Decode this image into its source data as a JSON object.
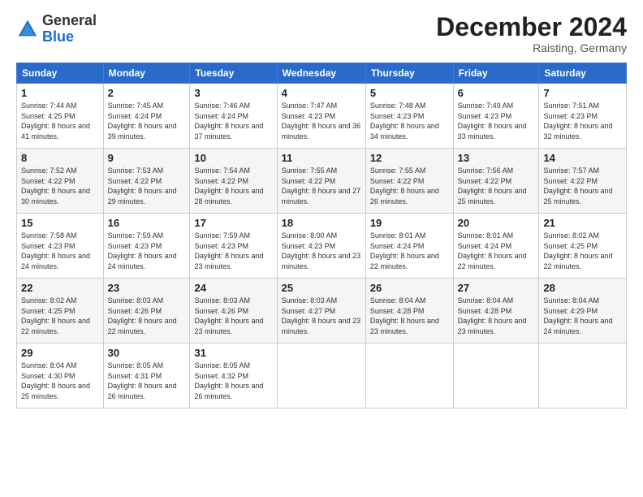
{
  "logo": {
    "general": "General",
    "blue": "Blue"
  },
  "header": {
    "month": "December 2024",
    "location": "Raisting, Germany"
  },
  "weekdays": [
    "Sunday",
    "Monday",
    "Tuesday",
    "Wednesday",
    "Thursday",
    "Friday",
    "Saturday"
  ],
  "weeks": [
    [
      {
        "day": "1",
        "sunrise": "7:44 AM",
        "sunset": "4:25 PM",
        "daylight": "8 hours and 41 minutes."
      },
      {
        "day": "2",
        "sunrise": "7:45 AM",
        "sunset": "4:24 PM",
        "daylight": "8 hours and 39 minutes."
      },
      {
        "day": "3",
        "sunrise": "7:46 AM",
        "sunset": "4:24 PM",
        "daylight": "8 hours and 37 minutes."
      },
      {
        "day": "4",
        "sunrise": "7:47 AM",
        "sunset": "4:23 PM",
        "daylight": "8 hours and 36 minutes."
      },
      {
        "day": "5",
        "sunrise": "7:48 AM",
        "sunset": "4:23 PM",
        "daylight": "8 hours and 34 minutes."
      },
      {
        "day": "6",
        "sunrise": "7:49 AM",
        "sunset": "4:23 PM",
        "daylight": "8 hours and 33 minutes."
      },
      {
        "day": "7",
        "sunrise": "7:51 AM",
        "sunset": "4:23 PM",
        "daylight": "8 hours and 32 minutes."
      }
    ],
    [
      {
        "day": "8",
        "sunrise": "7:52 AM",
        "sunset": "4:22 PM",
        "daylight": "8 hours and 30 minutes."
      },
      {
        "day": "9",
        "sunrise": "7:53 AM",
        "sunset": "4:22 PM",
        "daylight": "8 hours and 29 minutes."
      },
      {
        "day": "10",
        "sunrise": "7:54 AM",
        "sunset": "4:22 PM",
        "daylight": "8 hours and 28 minutes."
      },
      {
        "day": "11",
        "sunrise": "7:55 AM",
        "sunset": "4:22 PM",
        "daylight": "8 hours and 27 minutes."
      },
      {
        "day": "12",
        "sunrise": "7:55 AM",
        "sunset": "4:22 PM",
        "daylight": "8 hours and 26 minutes."
      },
      {
        "day": "13",
        "sunrise": "7:56 AM",
        "sunset": "4:22 PM",
        "daylight": "8 hours and 25 minutes."
      },
      {
        "day": "14",
        "sunrise": "7:57 AM",
        "sunset": "4:22 PM",
        "daylight": "8 hours and 25 minutes."
      }
    ],
    [
      {
        "day": "15",
        "sunrise": "7:58 AM",
        "sunset": "4:23 PM",
        "daylight": "8 hours and 24 minutes."
      },
      {
        "day": "16",
        "sunrise": "7:59 AM",
        "sunset": "4:23 PM",
        "daylight": "8 hours and 24 minutes."
      },
      {
        "day": "17",
        "sunrise": "7:59 AM",
        "sunset": "4:23 PM",
        "daylight": "8 hours and 23 minutes."
      },
      {
        "day": "18",
        "sunrise": "8:00 AM",
        "sunset": "4:23 PM",
        "daylight": "8 hours and 23 minutes."
      },
      {
        "day": "19",
        "sunrise": "8:01 AM",
        "sunset": "4:24 PM",
        "daylight": "8 hours and 22 minutes."
      },
      {
        "day": "20",
        "sunrise": "8:01 AM",
        "sunset": "4:24 PM",
        "daylight": "8 hours and 22 minutes."
      },
      {
        "day": "21",
        "sunrise": "8:02 AM",
        "sunset": "4:25 PM",
        "daylight": "8 hours and 22 minutes."
      }
    ],
    [
      {
        "day": "22",
        "sunrise": "8:02 AM",
        "sunset": "4:25 PM",
        "daylight": "8 hours and 22 minutes."
      },
      {
        "day": "23",
        "sunrise": "8:03 AM",
        "sunset": "4:26 PM",
        "daylight": "8 hours and 22 minutes."
      },
      {
        "day": "24",
        "sunrise": "8:03 AM",
        "sunset": "4:26 PM",
        "daylight": "8 hours and 23 minutes."
      },
      {
        "day": "25",
        "sunrise": "8:03 AM",
        "sunset": "4:27 PM",
        "daylight": "8 hours and 23 minutes."
      },
      {
        "day": "26",
        "sunrise": "8:04 AM",
        "sunset": "4:28 PM",
        "daylight": "8 hours and 23 minutes."
      },
      {
        "day": "27",
        "sunrise": "8:04 AM",
        "sunset": "4:28 PM",
        "daylight": "8 hours and 23 minutes."
      },
      {
        "day": "28",
        "sunrise": "8:04 AM",
        "sunset": "4:29 PM",
        "daylight": "8 hours and 24 minutes."
      }
    ],
    [
      {
        "day": "29",
        "sunrise": "8:04 AM",
        "sunset": "4:30 PM",
        "daylight": "8 hours and 25 minutes."
      },
      {
        "day": "30",
        "sunrise": "8:05 AM",
        "sunset": "4:31 PM",
        "daylight": "8 hours and 26 minutes."
      },
      {
        "day": "31",
        "sunrise": "8:05 AM",
        "sunset": "4:32 PM",
        "daylight": "8 hours and 26 minutes."
      },
      null,
      null,
      null,
      null
    ]
  ]
}
